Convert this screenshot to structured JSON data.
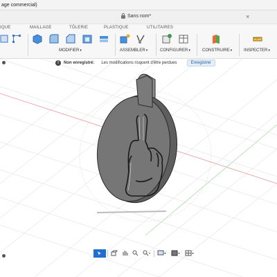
{
  "window": {
    "title": "age commercial)"
  },
  "document": {
    "title": "Sans nom*",
    "close_glyph": "×"
  },
  "ribbon": {
    "tabs": [
      {
        "label": "IQUE",
        "active": false
      },
      {
        "label": "MAILLAGE",
        "active": false
      },
      {
        "label": "TÔLERIE",
        "active": false
      },
      {
        "label": "PLASTIQUE",
        "active": false
      },
      {
        "label": "UTILITAIRES",
        "active": false
      }
    ],
    "groups": {
      "modifier": "MODIFIER",
      "assembler": "ASSEMBLER",
      "configurer": "CONFIGURER",
      "construire": "CONSTRUIRE",
      "inspecter": "INSPECTER"
    },
    "caret": "▾"
  },
  "warning": {
    "icon": "!",
    "label": "Non enregistré:",
    "message": "Les modifications risquent d'être perdues",
    "button": "Enregistrer"
  },
  "colors": {
    "accent": "#1f6fd1",
    "axis_red": "#e56b6b",
    "axis_green": "#6cc46c",
    "grid": "#d0d0d0",
    "model_face": "#707070",
    "model_edge": "#2a2a2a"
  },
  "icons": {
    "warning": "info-circle-icon",
    "lock": "lock-icon",
    "nav": [
      "select-icon",
      "orbit-icon",
      "pan-icon",
      "zoom-icon",
      "zoom-fit-icon",
      "display-settings-icon",
      "visual-style-icon",
      "grid-icon"
    ]
  }
}
